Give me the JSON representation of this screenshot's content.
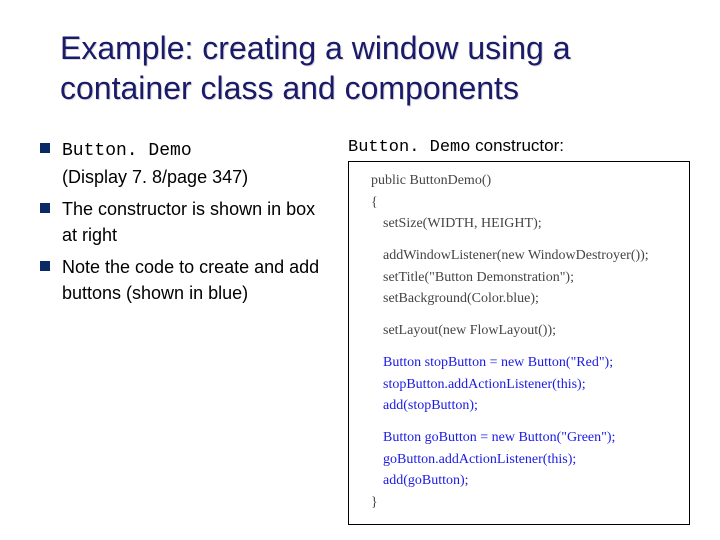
{
  "title": "Example: creating a window using a container class and components",
  "bullets": {
    "b1_mono": "Button. Demo",
    "b1_rest": "(Display 7. 8/page 347)",
    "b2": "The constructor is shown in box at right",
    "b3": "Note the code to create and add buttons (shown in blue)"
  },
  "codebox": {
    "title_mono": "Button. Demo",
    "title_rest": " constructor:",
    "l_sig": "public ButtonDemo()",
    "l_open": "{",
    "l_size": "setSize(WIDTH, HEIGHT);",
    "l_listener": "addWindowListener(new WindowDestroyer());",
    "l_title": "setTitle(\"Button Demonstration\");",
    "l_bg": "setBackground(Color.blue);",
    "l_layout": "setLayout(new FlowLayout());",
    "l_stop1": "Button stopButton = new Button(\"Red\");",
    "l_stop2": "stopButton.addActionListener(this);",
    "l_stop3": "add(stopButton);",
    "l_go1": "Button goButton = new Button(\"Green\");",
    "l_go2": "goButton.addActionListener(this);",
    "l_go3": "add(goButton);",
    "l_close": "}"
  }
}
